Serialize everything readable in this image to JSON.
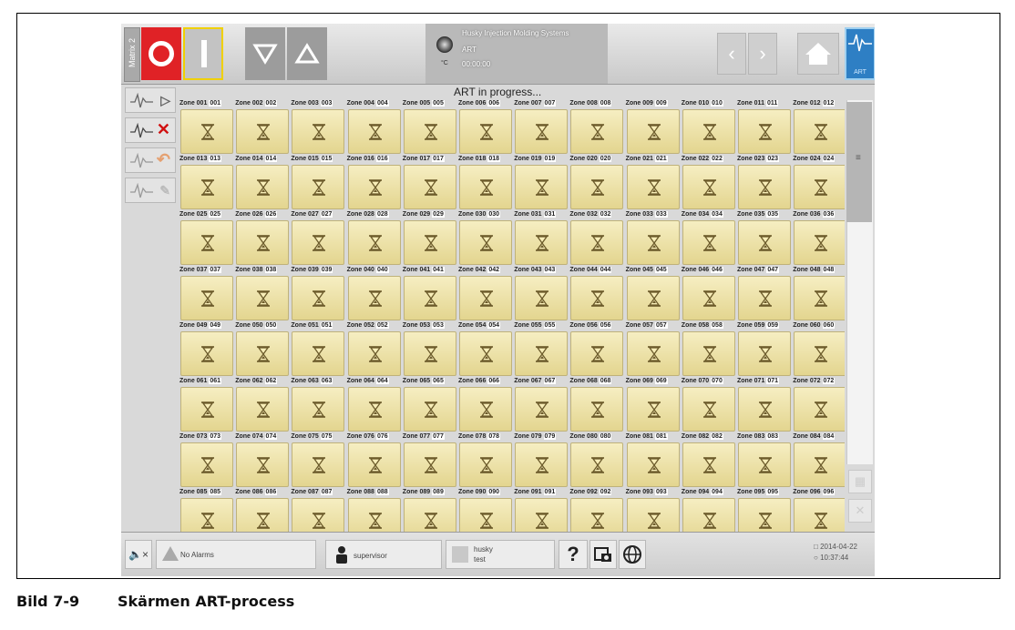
{
  "header": {
    "matrix_label": "Matrix 2",
    "status_title": "Husky Injection Molding Systems",
    "status_mode": "ART",
    "status_time": "00:00:00",
    "status_unit": "°C",
    "art_button_label": "ART"
  },
  "main": {
    "progress_title": "ART in progress..."
  },
  "zones": [
    {
      "name": "Zone 001",
      "num": "001",
      "icon": "hourglass-icon"
    },
    {
      "name": "Zone 002",
      "num": "002",
      "icon": "hourglass-icon"
    },
    {
      "name": "Zone 003",
      "num": "003",
      "icon": "hourglass-icon"
    },
    {
      "name": "Zone 004",
      "num": "004",
      "icon": "hourglass-icon"
    },
    {
      "name": "Zone 005",
      "num": "005",
      "icon": "hourglass-icon"
    },
    {
      "name": "Zone 006",
      "num": "006",
      "icon": "hourglass-icon"
    },
    {
      "name": "Zone 007",
      "num": "007",
      "icon": "hourglass-icon"
    },
    {
      "name": "Zone 008",
      "num": "008",
      "icon": "hourglass-icon"
    },
    {
      "name": "Zone 009",
      "num": "009",
      "icon": "hourglass-icon"
    },
    {
      "name": "Zone 010",
      "num": "010",
      "icon": "hourglass-icon"
    },
    {
      "name": "Zone 011",
      "num": "011",
      "icon": "hourglass-icon"
    },
    {
      "name": "Zone 012",
      "num": "012",
      "icon": "hourglass-icon"
    },
    {
      "name": "Zone 013",
      "num": "013",
      "icon": "hourglass-icon"
    },
    {
      "name": "Zone 014",
      "num": "014",
      "icon": "hourglass-icon"
    },
    {
      "name": "Zone 015",
      "num": "015",
      "icon": "hourglass-icon"
    },
    {
      "name": "Zone 016",
      "num": "016",
      "icon": "hourglass-icon"
    },
    {
      "name": "Zone 017",
      "num": "017",
      "icon": "hourglass-icon"
    },
    {
      "name": "Zone 018",
      "num": "018",
      "icon": "hourglass-icon"
    },
    {
      "name": "Zone 019",
      "num": "019",
      "icon": "hourglass-icon"
    },
    {
      "name": "Zone 020",
      "num": "020",
      "icon": "hourglass-icon"
    },
    {
      "name": "Zone 021",
      "num": "021",
      "icon": "hourglass-icon"
    },
    {
      "name": "Zone 022",
      "num": "022",
      "icon": "hourglass-icon"
    },
    {
      "name": "Zone 023",
      "num": "023",
      "icon": "hourglass-icon"
    },
    {
      "name": "Zone 024",
      "num": "024",
      "icon": "hourglass-icon"
    },
    {
      "name": "Zone 025",
      "num": "025",
      "icon": "hourglass-icon"
    },
    {
      "name": "Zone 026",
      "num": "026",
      "icon": "hourglass-icon"
    },
    {
      "name": "Zone 027",
      "num": "027",
      "icon": "hourglass-icon"
    },
    {
      "name": "Zone 028",
      "num": "028",
      "icon": "hourglass-icon"
    },
    {
      "name": "Zone 029",
      "num": "029",
      "icon": "hourglass-icon"
    },
    {
      "name": "Zone 030",
      "num": "030",
      "icon": "hourglass-icon"
    },
    {
      "name": "Zone 031",
      "num": "031",
      "icon": "hourglass-icon"
    },
    {
      "name": "Zone 032",
      "num": "032",
      "icon": "hourglass-icon"
    },
    {
      "name": "Zone 033",
      "num": "033",
      "icon": "hourglass-icon"
    },
    {
      "name": "Zone 034",
      "num": "034",
      "icon": "hourglass-icon"
    },
    {
      "name": "Zone 035",
      "num": "035",
      "icon": "hourglass-icon"
    },
    {
      "name": "Zone 036",
      "num": "036",
      "icon": "hourglass-icon"
    },
    {
      "name": "Zone 037",
      "num": "037",
      "icon": "hourglass-icon"
    },
    {
      "name": "Zone 038",
      "num": "038",
      "icon": "hourglass-icon"
    },
    {
      "name": "Zone 039",
      "num": "039",
      "icon": "hourglass-icon"
    },
    {
      "name": "Zone 040",
      "num": "040",
      "icon": "hourglass-icon"
    },
    {
      "name": "Zone 041",
      "num": "041",
      "icon": "hourglass-icon"
    },
    {
      "name": "Zone 042",
      "num": "042",
      "icon": "hourglass-icon"
    },
    {
      "name": "Zone 043",
      "num": "043",
      "icon": "hourglass-icon"
    },
    {
      "name": "Zone 044",
      "num": "044",
      "icon": "hourglass-icon"
    },
    {
      "name": "Zone 045",
      "num": "045",
      "icon": "hourglass-icon"
    },
    {
      "name": "Zone 046",
      "num": "046",
      "icon": "hourglass-icon"
    },
    {
      "name": "Zone 047",
      "num": "047",
      "icon": "hourglass-icon"
    },
    {
      "name": "Zone 048",
      "num": "048",
      "icon": "hourglass-icon"
    },
    {
      "name": "Zone 049",
      "num": "049",
      "icon": "hourglass-icon"
    },
    {
      "name": "Zone 050",
      "num": "050",
      "icon": "hourglass-icon"
    },
    {
      "name": "Zone 051",
      "num": "051",
      "icon": "hourglass-icon"
    },
    {
      "name": "Zone 052",
      "num": "052",
      "icon": "hourglass-icon"
    },
    {
      "name": "Zone 053",
      "num": "053",
      "icon": "hourglass-icon"
    },
    {
      "name": "Zone 054",
      "num": "054",
      "icon": "hourglass-icon"
    },
    {
      "name": "Zone 055",
      "num": "055",
      "icon": "hourglass-icon"
    },
    {
      "name": "Zone 056",
      "num": "056",
      "icon": "hourglass-icon"
    },
    {
      "name": "Zone 057",
      "num": "057",
      "icon": "hourglass-icon"
    },
    {
      "name": "Zone 058",
      "num": "058",
      "icon": "hourglass-icon"
    },
    {
      "name": "Zone 059",
      "num": "059",
      "icon": "hourglass-icon"
    },
    {
      "name": "Zone 060",
      "num": "060",
      "icon": "hourglass-icon"
    },
    {
      "name": "Zone 061",
      "num": "061",
      "icon": "hourglass-icon"
    },
    {
      "name": "Zone 062",
      "num": "062",
      "icon": "hourglass-icon"
    },
    {
      "name": "Zone 063",
      "num": "063",
      "icon": "hourglass-icon"
    },
    {
      "name": "Zone 064",
      "num": "064",
      "icon": "hourglass-icon"
    },
    {
      "name": "Zone 065",
      "num": "065",
      "icon": "hourglass-icon"
    },
    {
      "name": "Zone 066",
      "num": "066",
      "icon": "hourglass-icon"
    },
    {
      "name": "Zone 067",
      "num": "067",
      "icon": "hourglass-icon"
    },
    {
      "name": "Zone 068",
      "num": "068",
      "icon": "hourglass-icon"
    },
    {
      "name": "Zone 069",
      "num": "069",
      "icon": "hourglass-icon"
    },
    {
      "name": "Zone 070",
      "num": "070",
      "icon": "hourglass-icon"
    },
    {
      "name": "Zone 071",
      "num": "071",
      "icon": "hourglass-icon"
    },
    {
      "name": "Zone 072",
      "num": "072",
      "icon": "hourglass-icon"
    },
    {
      "name": "Zone 073",
      "num": "073",
      "icon": "hourglass-icon"
    },
    {
      "name": "Zone 074",
      "num": "074",
      "icon": "hourglass-icon"
    },
    {
      "name": "Zone 075",
      "num": "075",
      "icon": "hourglass-icon"
    },
    {
      "name": "Zone 076",
      "num": "076",
      "icon": "hourglass-icon"
    },
    {
      "name": "Zone 077",
      "num": "077",
      "icon": "hourglass-icon"
    },
    {
      "name": "Zone 078",
      "num": "078",
      "icon": "hourglass-icon"
    },
    {
      "name": "Zone 079",
      "num": "079",
      "icon": "hourglass-icon"
    },
    {
      "name": "Zone 080",
      "num": "080",
      "icon": "hourglass-icon"
    },
    {
      "name": "Zone 081",
      "num": "081",
      "icon": "hourglass-icon"
    },
    {
      "name": "Zone 082",
      "num": "082",
      "icon": "hourglass-icon"
    },
    {
      "name": "Zone 083",
      "num": "083",
      "icon": "hourglass-icon"
    },
    {
      "name": "Zone 084",
      "num": "084",
      "icon": "hourglass-icon"
    },
    {
      "name": "Zone 085",
      "num": "085",
      "icon": "hourglass-icon"
    },
    {
      "name": "Zone 086",
      "num": "086",
      "icon": "hourglass-icon"
    },
    {
      "name": "Zone 087",
      "num": "087",
      "icon": "hourglass-icon"
    },
    {
      "name": "Zone 088",
      "num": "088",
      "icon": "hourglass-icon"
    },
    {
      "name": "Zone 089",
      "num": "089",
      "icon": "hourglass-icon"
    },
    {
      "name": "Zone 090",
      "num": "090",
      "icon": "hourglass-icon"
    },
    {
      "name": "Zone 091",
      "num": "091",
      "icon": "hourglass-icon"
    },
    {
      "name": "Zone 092",
      "num": "092",
      "icon": "hourglass-icon"
    },
    {
      "name": "Zone 093",
      "num": "093",
      "icon": "hourglass-icon"
    },
    {
      "name": "Zone 094",
      "num": "094",
      "icon": "hourglass-icon"
    },
    {
      "name": "Zone 095",
      "num": "095",
      "icon": "hourglass-icon"
    },
    {
      "name": "Zone 096",
      "num": "096",
      "icon": "hourglass-icon"
    }
  ],
  "footer": {
    "alarm_text": "No Alarms",
    "user": "supervisor",
    "mold_name": "husky",
    "mold_sub": "test",
    "help": "?",
    "date": "2014-04-22",
    "time": "10:37:44"
  },
  "caption": {
    "number": "Bild 7-9",
    "text": "Skärmen ART-process"
  },
  "colors": {
    "stop": "#e02226",
    "zone_tile": "#efe3a8",
    "art_button": "#2e7fc4"
  }
}
